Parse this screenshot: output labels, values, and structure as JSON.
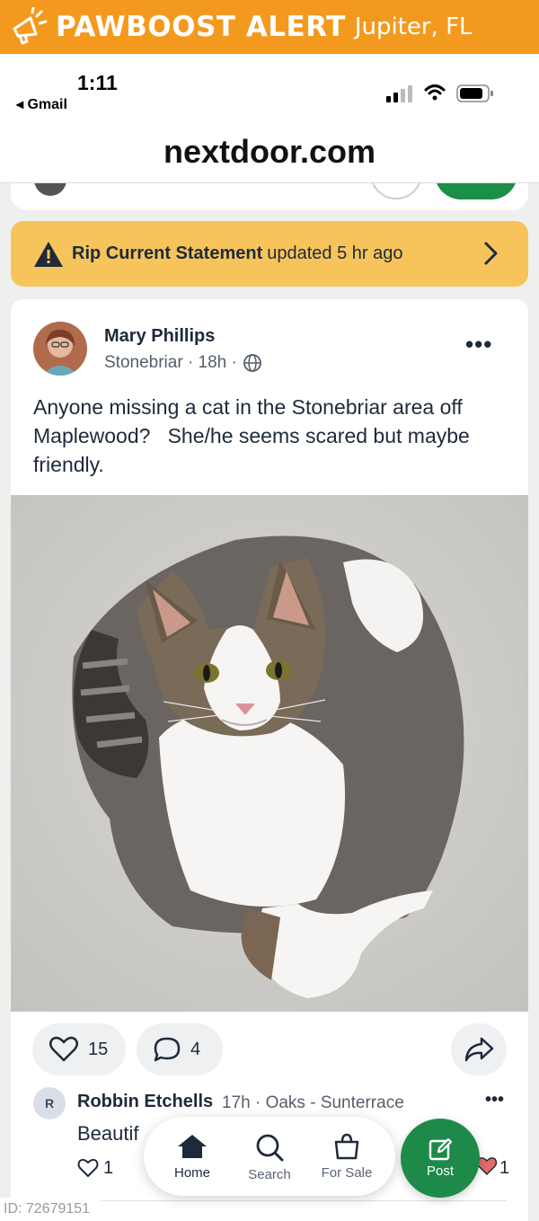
{
  "alert_banner": {
    "title": "PAWBOOST ALERT",
    "city": "Jupiter, FL"
  },
  "status_bar": {
    "time": "1:11",
    "back_label": "◂ Gmail"
  },
  "browser": {
    "url": "nextdoor.com"
  },
  "rip_banner": {
    "title": "Rip Current Statement",
    "updated": "updated 5 hr ago"
  },
  "post": {
    "author": "Mary Phillips",
    "meta": "Stonebriar · 18h ·",
    "text": "Anyone missing a cat in the Stonebriar area off Maplewood?   She/he seems scared but maybe friendly.",
    "like_count": "15",
    "comment_count": "4"
  },
  "comment": {
    "avatar_initial": "R",
    "author": "Robbin Etchells",
    "meta": "17h · Oaks - Sunterrace",
    "text": "Beautif",
    "like_count": "1",
    "reaction_count": "1"
  },
  "nav": {
    "home": "Home",
    "search": "Search",
    "for_sale": "For Sale",
    "post": "Post"
  },
  "footer": {
    "id_label": "ID: 72679151"
  },
  "colors": {
    "alert_orange": "#f39a1e",
    "rip_yellow": "#f6c45a",
    "nextdoor_green": "#1e8a4a",
    "text_dark": "#1e2a3a"
  }
}
